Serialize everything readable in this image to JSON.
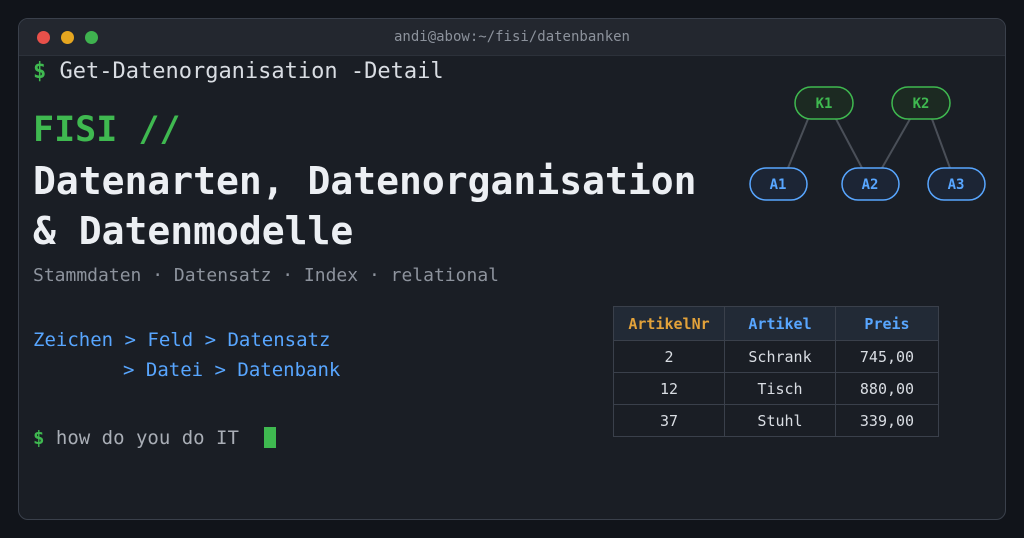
{
  "window": {
    "title": "andi@abow:~/fisi/datenbanken",
    "controls": {
      "close_color": "#e8504a",
      "minimize_color": "#e6a620",
      "maximize_color": "#3fb24f"
    }
  },
  "colors": {
    "accent_green": "#3fb950",
    "accent_blue": "#58a6ff",
    "accent_orange": "#e3a23a"
  },
  "terminal": {
    "prompt_symbol": "$",
    "command": "Get-Datenorganisation -Detail",
    "heading_tag": "FISI //",
    "headline_line1": "Datenarten, Datenorganisation",
    "headline_line2": "& Datenmodelle",
    "tags": "Stammdaten · Datensatz · Index · relational",
    "path_line1": "Zeichen > Feld > Datensatz",
    "path_line2": "> Datei > Datenbank",
    "bottom_prompt_symbol": "$",
    "bottom_prompt_text": "how do you do IT"
  },
  "diagram": {
    "nodes": {
      "k1": "K1",
      "k2": "K2",
      "a1": "A1",
      "a2": "A2",
      "a3": "A3"
    }
  },
  "table": {
    "headers": [
      "ArtikelNr",
      "Artikel",
      "Preis"
    ],
    "rows": [
      [
        "2",
        "Schrank",
        "745,00"
      ],
      [
        "12",
        "Tisch",
        "880,00"
      ],
      [
        "37",
        "Stuhl",
        "339,00"
      ]
    ]
  }
}
